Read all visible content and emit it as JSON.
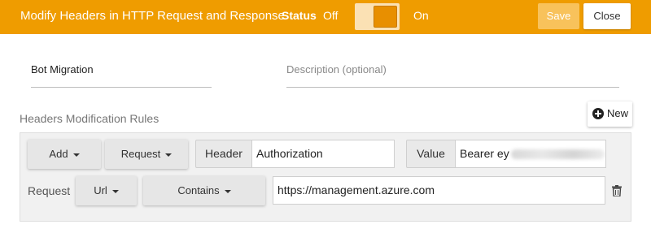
{
  "header": {
    "title": "Modify Headers in HTTP Request and Response",
    "status_label": "Status",
    "off_label": "Off",
    "on_label": "On",
    "save_label": "Save",
    "close_label": "Close",
    "accent_color": "#ef9c00"
  },
  "form": {
    "name_value": "Bot Migration",
    "description_placeholder": "Description (optional)"
  },
  "rules": {
    "section_label": "Headers Modification Rules",
    "new_label": "New",
    "rule": {
      "action": "Add",
      "target": "Request",
      "header_label": "Header",
      "header_value": "Authorization",
      "value_label": "Value",
      "value_value": "Bearer ey",
      "condition_label": "Request",
      "condition_field": "Url",
      "condition_operator": "Contains",
      "condition_value": "https://management.azure.com"
    }
  }
}
